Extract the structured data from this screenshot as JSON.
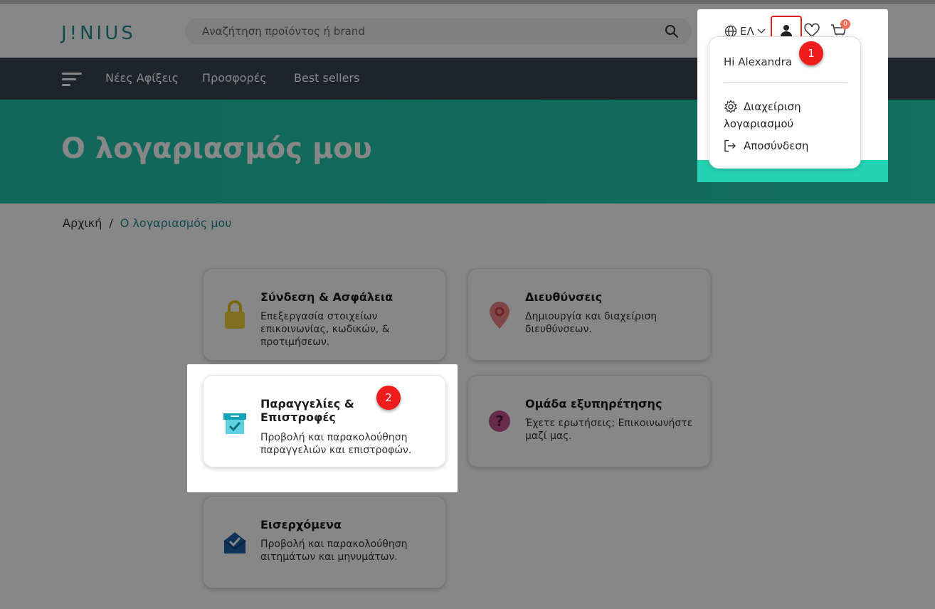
{
  "brand": {
    "logo_text": "J!NIUS"
  },
  "search": {
    "placeholder": "Αναζήτηση προϊόντος ή brand"
  },
  "nav": {
    "links": [
      "Νέες Αφίξεις",
      "Προσφορές",
      "Best sellers"
    ]
  },
  "hero": {
    "title": "Ο λογαριασμός μου"
  },
  "breadcrumb": {
    "home": "Αρχική",
    "separator": "/",
    "current": "Ο λογαριασμός μου"
  },
  "header_actions": {
    "language": "ΕΛ",
    "cart_count": "0"
  },
  "user_menu": {
    "greeting": "Hi Alexandra",
    "manage_account": "Διαχείριση λογαριασμού",
    "logout": "Αποσύνδεση"
  },
  "cards": [
    {
      "title": "Σύνδεση & Ασφάλεια",
      "desc": "Επεξεργασία στοιχείων επικοινωνίας, κωδικών, & προτιμήσεων.",
      "icon": "lock-icon"
    },
    {
      "title": "Διευθύνσεις",
      "desc": "Δημιουργία και διαχείριση διευθύνσεων.",
      "icon": "location-pin-icon"
    },
    {
      "title": "Παραγγελίες & Επιστροφές",
      "desc": "Προβολή και παρακολούθηση παραγγελιών και επιστροφών.",
      "icon": "order-box-icon"
    },
    {
      "title": "Ομάδα εξυπηρέτησης",
      "desc": "Έχετε ερωτήσεις; Επικοινωνήστε μαζί μας.",
      "icon": "help-question-icon"
    },
    {
      "title": "Εισερχόμενα",
      "desc": "Προβολή και παρακολούθηση αιτημάτων και μηνυμάτων.",
      "icon": "inbox-envelope-icon"
    }
  ],
  "steps": [
    "1",
    "2"
  ],
  "colors": {
    "accent": "#1f8f93",
    "hero": "#21c3a9",
    "navbar": "#3a4353",
    "step_marker": "#ee1c1c"
  }
}
